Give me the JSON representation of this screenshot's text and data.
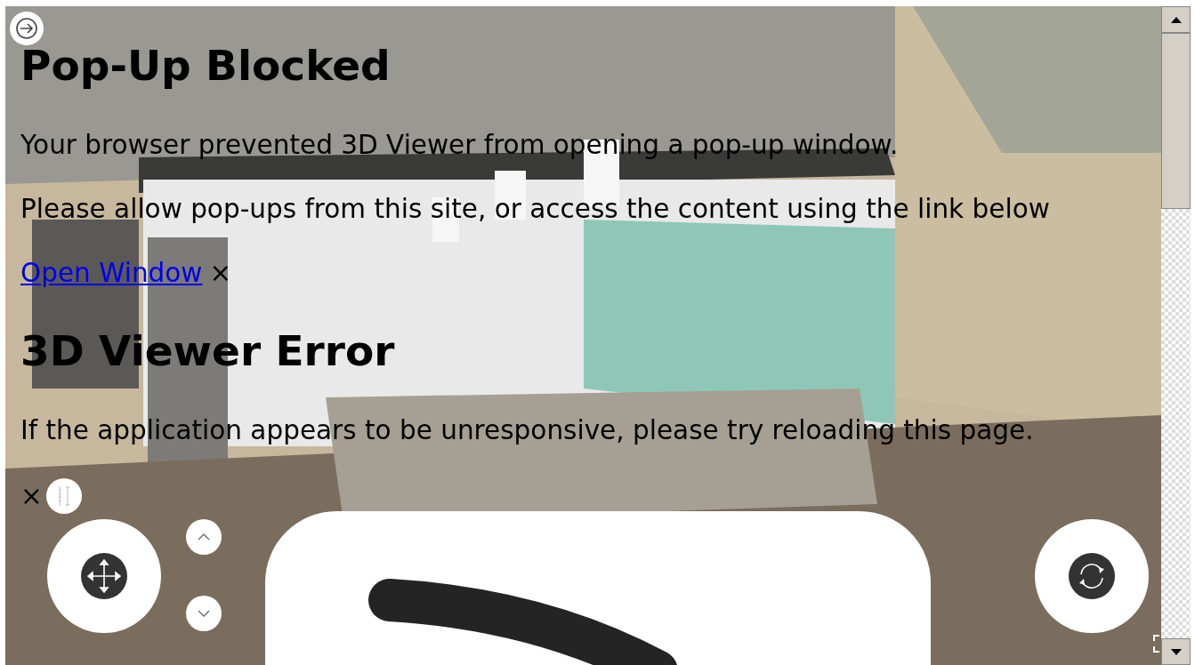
{
  "popup": {
    "title": "Pop-Up Blocked",
    "message": "Your browser prevented 3D Viewer from opening a pop-up window.",
    "instruction": "Please allow pop-ups from this site, or access the content using the link below",
    "link": "Open Window",
    "close": "×"
  },
  "error": {
    "title": "3D Viewer Error",
    "message": "If the application appears to be unresponsive, please try reloading this page.",
    "close": "×"
  }
}
